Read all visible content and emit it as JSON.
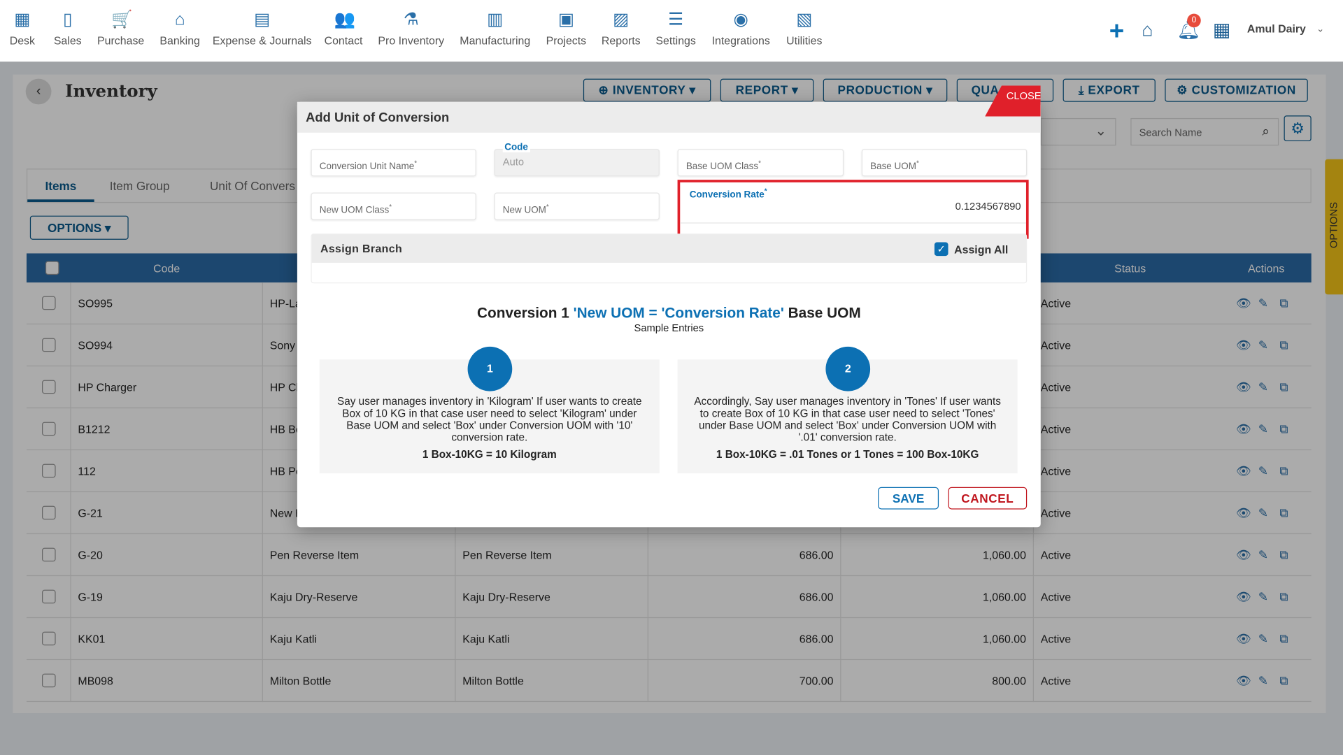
{
  "nav": [
    {
      "label": "Desk",
      "icon": "desk-icon",
      "glyph": "▦"
    },
    {
      "label": "Sales",
      "icon": "sales-icon",
      "glyph": "▯"
    },
    {
      "label": "Purchase",
      "icon": "cart-icon",
      "glyph": "🛒"
    },
    {
      "label": "Banking",
      "icon": "bank-icon",
      "glyph": "⌂"
    },
    {
      "label": "Expense & Journals",
      "icon": "journal-icon",
      "glyph": "▤"
    },
    {
      "label": "Contact",
      "icon": "contact-icon",
      "glyph": "👥"
    },
    {
      "label": "Pro Inventory",
      "icon": "inventory-icon",
      "glyph": "⚗"
    },
    {
      "label": "Manufacturing",
      "icon": "factory-icon",
      "glyph": "▥"
    },
    {
      "label": "Projects",
      "icon": "projects-icon",
      "glyph": "▣"
    },
    {
      "label": "Reports",
      "icon": "reports-icon",
      "glyph": "▨"
    },
    {
      "label": "Settings",
      "icon": "sliders-icon",
      "glyph": "☰"
    },
    {
      "label": "Integrations",
      "icon": "integrations-icon",
      "glyph": "◉"
    },
    {
      "label": "Utilities",
      "icon": "utilities-icon",
      "glyph": "▧"
    }
  ],
  "header": {
    "company": "Amul Dairy",
    "notifications": "0"
  },
  "page": {
    "title": "Inventory",
    "buttons": [
      "INVENTORY",
      "REPORT",
      "PRODUCTION",
      "QUA",
      "EXPORT",
      "CUSTOMIZATION"
    ],
    "close": "CLOSE",
    "search_placeholder": "Search Name",
    "tabs": [
      "Items",
      "Item Group",
      "Unit Of Convers"
    ],
    "options": "OPTIONS",
    "side_options": "OPTIONS"
  },
  "table": {
    "headers": {
      "code": "Code",
      "status": "Status",
      "actions": "Actions"
    },
    "rows": [
      [
        "SO995",
        "HP-La",
        "",
        "",
        "",
        "Active"
      ],
      [
        "SO994",
        "Sony",
        "",
        "",
        "",
        "Active"
      ],
      [
        "HP Charger",
        "HP Cl",
        "",
        "",
        "",
        "Active"
      ],
      [
        "B1212",
        "HB Bc",
        "",
        "",
        "",
        "Active"
      ],
      [
        "112",
        "HB Pe",
        "",
        "",
        "",
        "Active"
      ],
      [
        "G-21",
        "New H",
        "",
        "",
        "",
        "Active"
      ],
      [
        "G-20",
        "Pen Reverse Item",
        "Pen Reverse Item",
        "686.00",
        "1,060.00",
        "Active"
      ],
      [
        "G-19",
        "Kaju Dry-Reserve",
        "Kaju Dry-Reserve",
        "686.00",
        "1,060.00",
        "Active"
      ],
      [
        "KK01",
        "Kaju Katli",
        "Kaju Katli",
        "686.00",
        "1,060.00",
        "Active"
      ],
      [
        "MB098",
        "Milton Bottle",
        "Milton Bottle",
        "700.00",
        "800.00",
        "Active"
      ]
    ]
  },
  "modal": {
    "title": "Add Unit of Conversion",
    "fields": {
      "conversion_unit_name": "Conversion Unit Name",
      "code_label": "Code",
      "code_value": "Auto",
      "base_uom_class": "Base UOM Class",
      "base_uom": "Base UOM",
      "new_uom_class": "New UOM Class",
      "new_uom": "New UOM",
      "conversion_rate_label": "Conversion Rate",
      "conversion_rate_value": "0.1234567890"
    },
    "assign_branch": "Assign Branch",
    "assign_all": "Assign All",
    "assign_all_checked": true,
    "formula_prefix": "Conversion 1",
    "formula_highlight": "'New UOM = 'Conversion Rate'",
    "formula_suffix": "Base UOM",
    "sample": "Sample Entries",
    "cards": [
      {
        "num": "1",
        "text": "Say user manages inventory in 'Kilogram' If user wants to create Box of 10 KG in that case user need to select 'Kilogram' under Base UOM and select 'Box' under Conversion UOM with '10' conversion rate.",
        "result": "1 Box-10KG = 10 Kilogram"
      },
      {
        "num": "2",
        "text": "Accordingly, Say user manages inventory in 'Tones' If user wants to create Box of 10 KG in that case user need to select 'Tones' under Base UOM and select 'Box' under Conversion UOM with '.01' conversion rate.",
        "result": "1 Box-10KG = .01 Tones or 1 Tones = 100 Box-10KG"
      }
    ],
    "save": "SAVE",
    "cancel": "CANCEL"
  },
  "colors": {
    "primary": "#0c70b3",
    "danger": "#e0202a",
    "side_tab": "#f5c518"
  }
}
